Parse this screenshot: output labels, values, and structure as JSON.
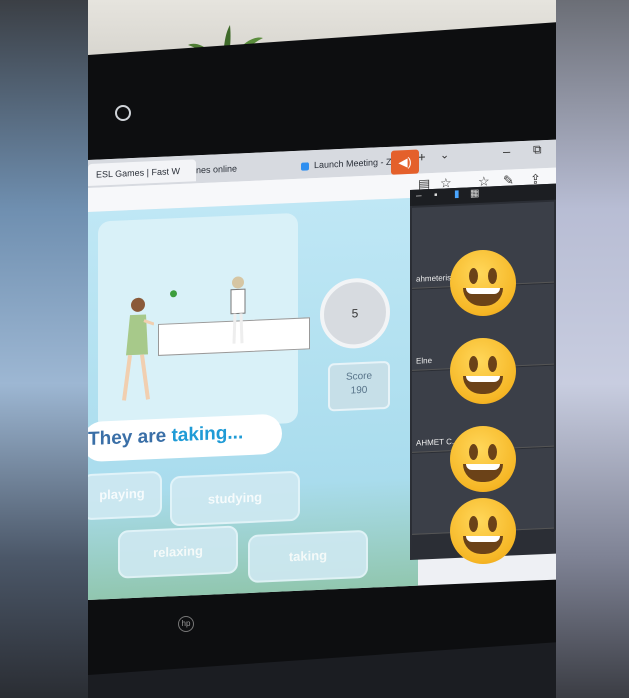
{
  "browser": {
    "tabs": [
      {
        "label": "ESL Games | Fast W"
      },
      {
        "label": "nes online"
      },
      {
        "label": "Launch Meeting - Zoom"
      }
    ],
    "new_tab": "+",
    "tab_list": "⌄",
    "window_min": "–",
    "window_max": "⧉",
    "toolbar_icons": [
      "reader-icon",
      "favorite-icon",
      "favorites-bar-icon",
      "pen-icon",
      "share-icon"
    ]
  },
  "game": {
    "timer": "5",
    "score_label": "Score",
    "score_value": "190",
    "prompt_text": "They are",
    "prompt_answer": "taking",
    "prompt_dots": "...",
    "options": [
      "playing",
      "studying",
      "relaxing",
      "taking"
    ]
  },
  "zoom": {
    "participants": [
      {
        "name": "ahmeteristof"
      },
      {
        "name": "Elne"
      },
      {
        "name": "AHMET C..."
      },
      {
        "name": ""
      }
    ]
  },
  "colors": {
    "accent_orange": "#e4602b",
    "prompt_blue": "#3a6fa7",
    "answer_blue": "#1f9bd6",
    "emoji_yellow": "#f6b726"
  }
}
